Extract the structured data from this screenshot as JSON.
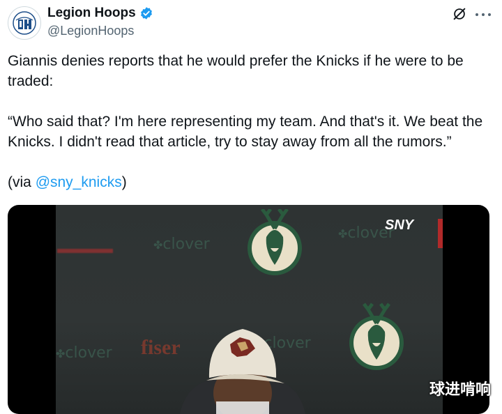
{
  "author": {
    "display_name": "Legion Hoops",
    "handle": "@LegionHoops",
    "verified": true,
    "avatar_icon": "legion-hoops-logo",
    "verified_icon": "verified-badge-icon"
  },
  "header_actions": {
    "grok_icon": "grok-icon",
    "more_icon": "more-options-icon"
  },
  "tweet": {
    "line1": "Giannis denies reports that he would prefer the Knicks if he were to be traded:",
    "quote": "“Who said that? I'm here representing my team. And that's it. We beat the Knicks. I didn't read that article, try to stay away from all the rumors.”",
    "via_prefix": "(via ",
    "via_mention": "@sny_knicks",
    "via_suffix": ")"
  },
  "media": {
    "overlay_logo": "SNY",
    "sponsor_text": "clover",
    "sponsor_text_2": "fiser",
    "watermark": "球进啃响"
  },
  "colors": {
    "accent": "#1d9bf0",
    "text": "#0f1419",
    "secondary": "#536471"
  }
}
